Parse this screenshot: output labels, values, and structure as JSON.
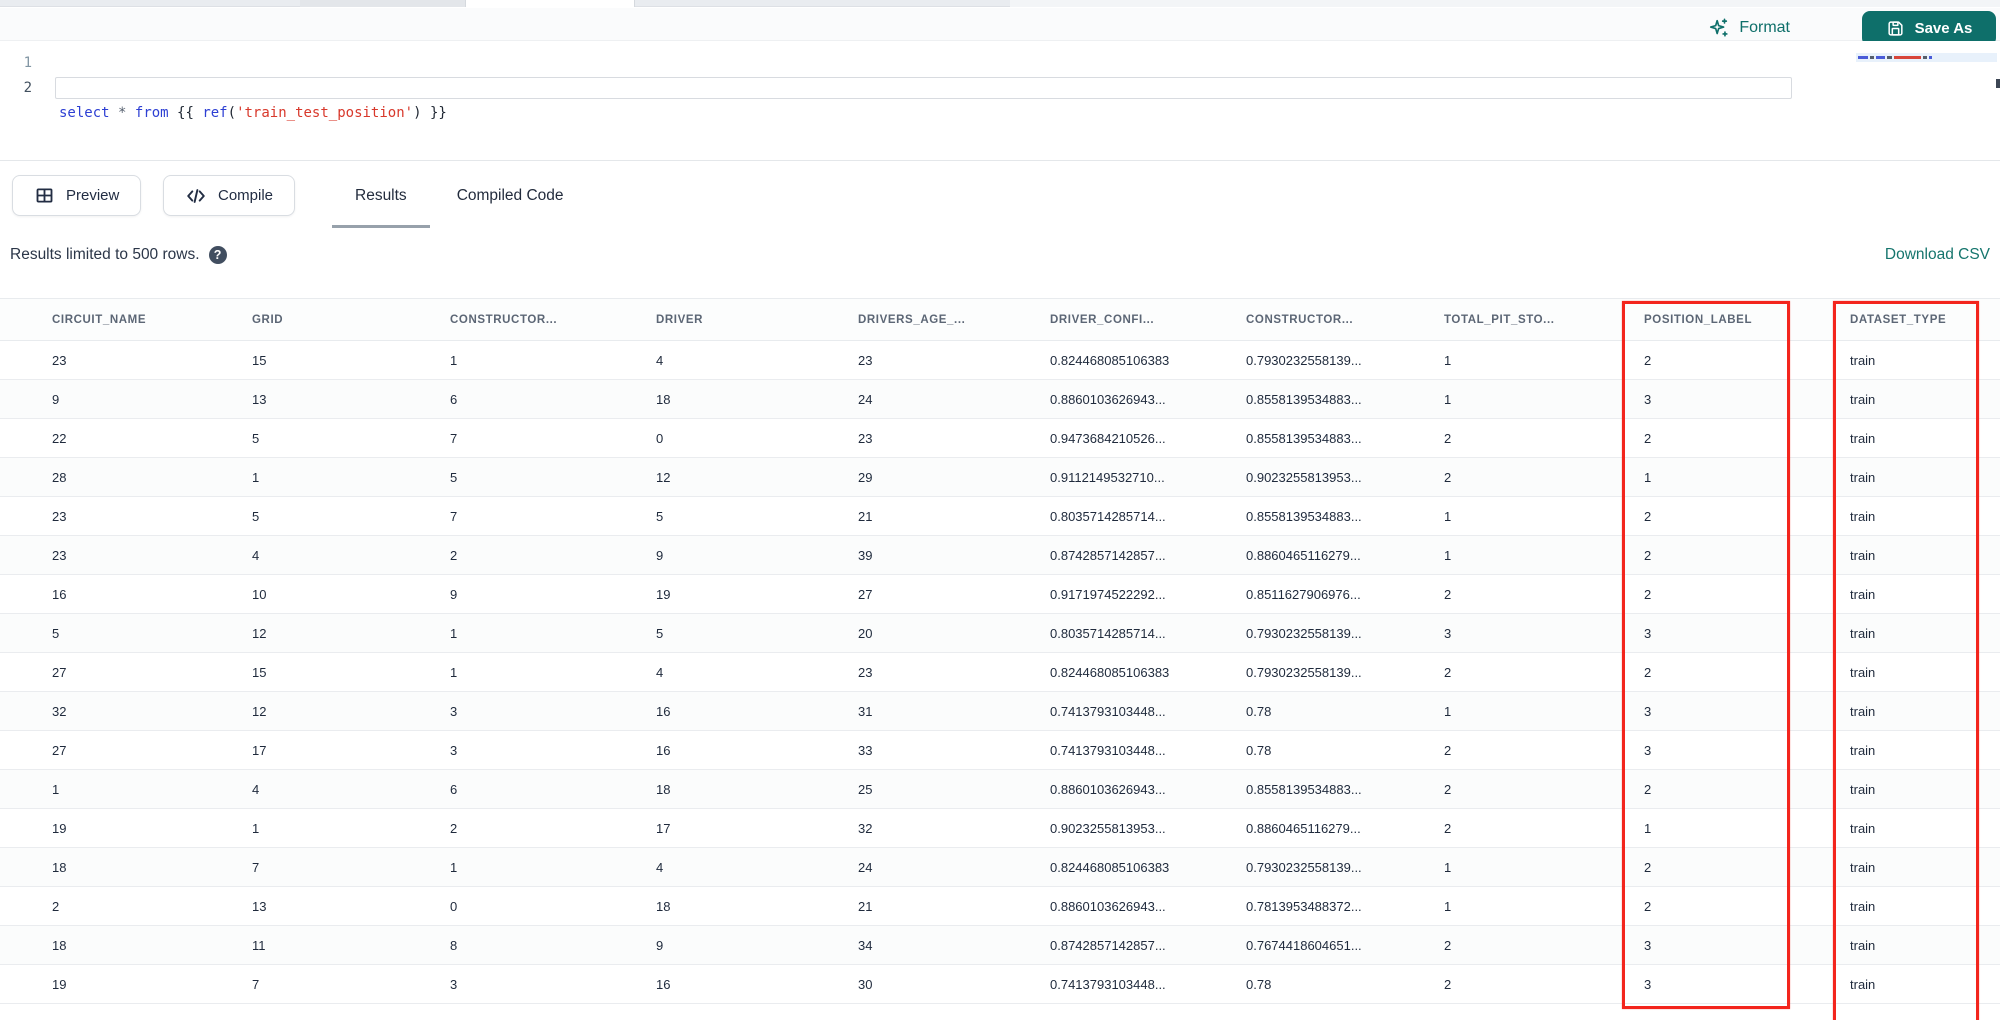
{
  "colors": {
    "teal": "#0E6F6A",
    "link": "#15756D",
    "highlight_red": "#F3251D",
    "keyword_blue": "#2D3FD3",
    "string_red": "#D8382B",
    "header_text": "#5C6675",
    "cell_text": "#1F2A3C"
  },
  "toolbar": {
    "format_label": "Format",
    "save_as_label": "Save As",
    "format_icon": "sparkles-icon",
    "save_icon": "floppy-disk-icon"
  },
  "editor": {
    "line_numbers": [
      "1",
      "2"
    ],
    "code_line": "select * from {{ ref('train_test_position') }}",
    "code_tokens": [
      {
        "text": "select",
        "type": "kw"
      },
      {
        "text": " ",
        "type": "plain"
      },
      {
        "text": "*",
        "type": "op"
      },
      {
        "text": " ",
        "type": "plain"
      },
      {
        "text": "from",
        "type": "kw"
      },
      {
        "text": " {{ ",
        "type": "plain"
      },
      {
        "text": "ref",
        "type": "fn"
      },
      {
        "text": "(",
        "type": "plain"
      },
      {
        "text": "'train_test_position'",
        "type": "str"
      },
      {
        "text": ")",
        "type": "plain"
      },
      {
        "text": " }}",
        "type": "plain"
      }
    ]
  },
  "panel": {
    "preview_label": "Preview",
    "compile_label": "Compile",
    "preview_icon": "table-grid-icon",
    "compile_icon": "code-brackets-icon",
    "tabs": [
      {
        "label": "Results",
        "active": true
      },
      {
        "label": "Compiled Code",
        "active": false
      }
    ]
  },
  "results": {
    "limit_text": "Results limited to 500 rows.",
    "help_glyph": "?",
    "help_icon": "question-mark-circle-icon",
    "download_label": "Download CSV"
  },
  "table": {
    "columns": [
      "CIRCUIT_NAME",
      "GRID",
      "CONSTRUCTOR...",
      "DRIVER",
      "DRIVERS_AGE_...",
      "DRIVER_CONFI...",
      "CONSTRUCTOR...",
      "TOTAL_PIT_STO...",
      "POSITION_LABEL",
      "DATASET_TYPE"
    ],
    "rows": [
      [
        "23",
        "15",
        "1",
        "4",
        "23",
        "0.824468085106383",
        "0.7930232558139...",
        "1",
        "2",
        "train"
      ],
      [
        "9",
        "13",
        "6",
        "18",
        "24",
        "0.8860103626943...",
        "0.8558139534883...",
        "1",
        "3",
        "train"
      ],
      [
        "22",
        "5",
        "7",
        "0",
        "23",
        "0.9473684210526...",
        "0.8558139534883...",
        "2",
        "2",
        "train"
      ],
      [
        "28",
        "1",
        "5",
        "12",
        "29",
        "0.9112149532710...",
        "0.9023255813953...",
        "2",
        "1",
        "train"
      ],
      [
        "23",
        "5",
        "7",
        "5",
        "21",
        "0.8035714285714...",
        "0.8558139534883...",
        "1",
        "2",
        "train"
      ],
      [
        "23",
        "4",
        "2",
        "9",
        "39",
        "0.8742857142857...",
        "0.8860465116279...",
        "1",
        "2",
        "train"
      ],
      [
        "16",
        "10",
        "9",
        "19",
        "27",
        "0.9171974522292...",
        "0.8511627906976...",
        "2",
        "2",
        "train"
      ],
      [
        "5",
        "12",
        "1",
        "5",
        "20",
        "0.8035714285714...",
        "0.7930232558139...",
        "3",
        "3",
        "train"
      ],
      [
        "27",
        "15",
        "1",
        "4",
        "23",
        "0.824468085106383",
        "0.7930232558139...",
        "2",
        "2",
        "train"
      ],
      [
        "32",
        "12",
        "3",
        "16",
        "31",
        "0.7413793103448...",
        "0.78",
        "1",
        "3",
        "train"
      ],
      [
        "27",
        "17",
        "3",
        "16",
        "33",
        "0.7413793103448...",
        "0.78",
        "2",
        "3",
        "train"
      ],
      [
        "1",
        "4",
        "6",
        "18",
        "25",
        "0.8860103626943...",
        "0.8558139534883...",
        "2",
        "2",
        "train"
      ],
      [
        "19",
        "1",
        "2",
        "17",
        "32",
        "0.9023255813953...",
        "0.8860465116279...",
        "2",
        "1",
        "train"
      ],
      [
        "18",
        "7",
        "1",
        "4",
        "24",
        "0.824468085106383",
        "0.7930232558139...",
        "1",
        "2",
        "train"
      ],
      [
        "2",
        "13",
        "0",
        "18",
        "21",
        "0.8860103626943...",
        "0.7813953488372...",
        "1",
        "2",
        "train"
      ],
      [
        "18",
        "11",
        "8",
        "9",
        "34",
        "0.8742857142857...",
        "0.7674418604651...",
        "2",
        "3",
        "train"
      ],
      [
        "19",
        "7",
        "3",
        "16",
        "30",
        "0.7413793103448...",
        "0.78",
        "2",
        "3",
        "train"
      ]
    ]
  },
  "annotations": {
    "highlighted_columns": [
      "POSITION_LABEL",
      "DATASET_TYPE"
    ],
    "color": "#F3251D"
  }
}
